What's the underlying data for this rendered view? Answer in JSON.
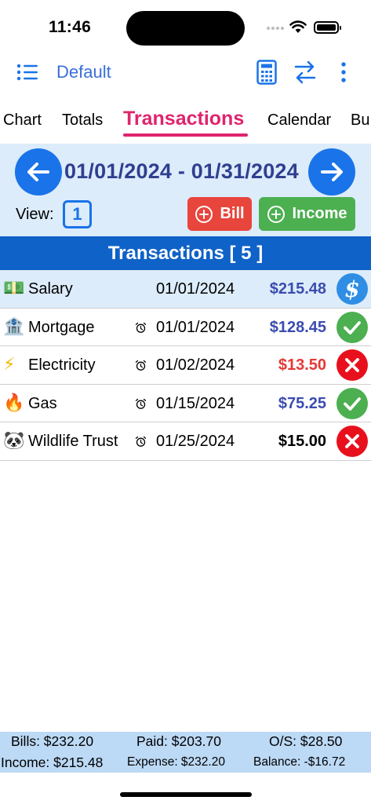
{
  "status_bar": {
    "time": "11:46"
  },
  "top_nav": {
    "profile": "Default"
  },
  "tabs": [
    {
      "label": "Chart"
    },
    {
      "label": "Totals"
    },
    {
      "label": "Transactions"
    },
    {
      "label": "Calendar"
    },
    {
      "label": "Bu"
    }
  ],
  "period": {
    "range": "01/01/2024 - 01/31/2024",
    "view_label": "View:",
    "view_value": "1",
    "bill_label": "Bill",
    "income_label": "Income"
  },
  "section": {
    "title": "Transactions [ 5 ]"
  },
  "transactions": [
    {
      "emoji": "💵",
      "name": "Salary",
      "date": "01/01/2024",
      "amount": "$215.48",
      "status": "dollar"
    },
    {
      "emoji": "🏦",
      "name": "Mortgage",
      "date": "01/01/2024",
      "amount": "$128.45",
      "status": "paid"
    },
    {
      "emoji": "⚡",
      "name": "Electricity",
      "date": "01/02/2024",
      "amount": "$13.50",
      "status": "unpaid"
    },
    {
      "emoji": "🔥",
      "name": "Gas",
      "date": "01/15/2024",
      "amount": "$75.25",
      "status": "paid"
    },
    {
      "emoji": "🐼",
      "name": "Wildlife Trust",
      "date": "01/25/2024",
      "amount": "$15.00",
      "status": "unpaid"
    }
  ],
  "summary": {
    "bills": "Bills: $232.20",
    "paid": "Paid: $203.70",
    "outstanding": "O/S: $28.50",
    "income": "Income: $215.48",
    "expense": "Expense: $232.20",
    "balance": "Balance: -$16.72"
  },
  "colors": {
    "accent": "#1a73e8",
    "active_tab": "#e0246e",
    "header_bg": "#0f62c7",
    "panel_bg": "#dcecfb",
    "bill": "#e8453c",
    "income": "#4caf50"
  }
}
